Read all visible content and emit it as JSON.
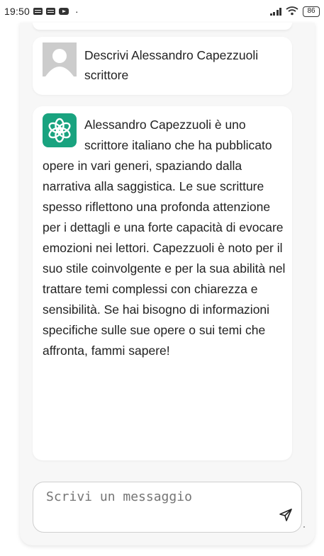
{
  "status_bar": {
    "time": "19:50",
    "left_icons": [
      "message-icon",
      "message-icon",
      "youtube-icon"
    ],
    "dot": "·",
    "right_icons": [
      "signal-icon",
      "wifi-icon",
      "battery-icon"
    ],
    "battery": "86"
  },
  "chat": {
    "messages": [
      {
        "role": "user",
        "avatar": "user-avatar-icon",
        "text": "Descrivi Alessandro Capezzuoli scrittore"
      },
      {
        "role": "assistant",
        "avatar": "openai-logo-icon",
        "text": "Alessandro Capezzuoli è uno scrittore italiano che ha pubblicato opere in vari generi, spaziando dalla narrativa alla saggistica. Le sue scritture spesso riflettono una profonda attenzione per i dettagli e una forte capacità di evocare emozioni nei lettori. Capezzuoli è noto per il suo stile coinvolgente e per la sua abilità nel trattare temi complessi con chiarezza e sensibilità. Se hai bisogno di informazioni specifiche sulle sue opere o sui temi che affronta, fammi sapere!"
      }
    ]
  },
  "composer": {
    "placeholder": "Scrivi un messaggio",
    "send_icon": "send-icon"
  },
  "colors": {
    "accent": "#19a37f",
    "card_bg": "#f7f7f7",
    "bubble_bg": "#ffffff"
  }
}
